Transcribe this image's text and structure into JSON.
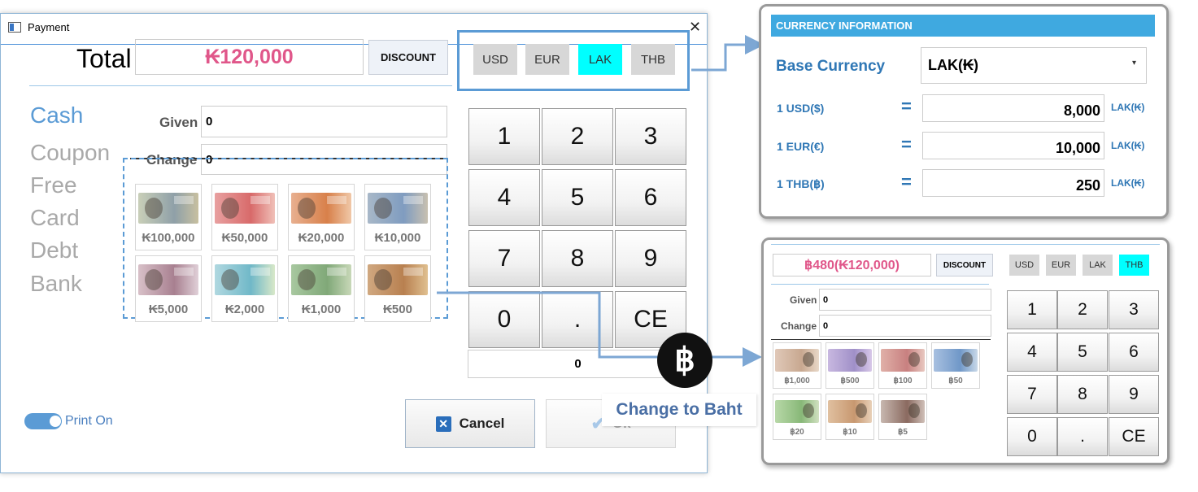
{
  "window": {
    "title": "Payment"
  },
  "total": {
    "label": "Total",
    "value": "₭120,000"
  },
  "discount_label": "DISCOUNT",
  "currencies": [
    "USD",
    "EUR",
    "LAK",
    "THB"
  ],
  "active_currency": "LAK",
  "payment_methods": [
    "Cash",
    "Coupon",
    "Free",
    "Card",
    "Debt",
    "Bank"
  ],
  "active_method": "Cash",
  "given": {
    "label": "Given",
    "value": "0"
  },
  "change": {
    "label": "Change",
    "value": "0"
  },
  "banknotes": [
    "₭100,000",
    "₭50,000",
    "₭20,000",
    "₭10,000",
    "₭5,000",
    "₭2,000",
    "₭1,000",
    "₭500"
  ],
  "keypad": [
    "1",
    "2",
    "3",
    "4",
    "5",
    "6",
    "7",
    "8",
    "9",
    "0",
    ".",
    "CE"
  ],
  "keypad_display": "0",
  "print_toggle": {
    "label": "Print On",
    "on": true
  },
  "cancel_label": "Cancel",
  "ok_label": "Ok",
  "currency_info": {
    "header": "CURRENCY INFORMATION",
    "base_label": "Base Currency",
    "base_value": "LAK(₭)",
    "rates": [
      {
        "label": "1 USD($)",
        "eq": "=",
        "value": "8,000",
        "unit": "LAK(₭)"
      },
      {
        "label": "1 EUR(€)",
        "eq": "=",
        "value": "10,000",
        "unit": "LAK(₭)"
      },
      {
        "label": "1 THB(฿)",
        "eq": "=",
        "value": "250",
        "unit": "LAK(₭)"
      }
    ]
  },
  "annotation": {
    "badge": "฿",
    "text": "Change to Baht"
  },
  "preview": {
    "total": "฿480(₭120,000)",
    "discount_label": "DISCOUNT",
    "currencies": [
      "USD",
      "EUR",
      "LAK",
      "THB"
    ],
    "active_currency": "THB",
    "given": {
      "label": "Given",
      "value": "0"
    },
    "change": {
      "label": "Change",
      "value": "0"
    },
    "banknotes": [
      "฿1,000",
      "฿500",
      "฿100",
      "฿50",
      "฿20",
      "฿10",
      "฿5"
    ],
    "keypad": [
      "1",
      "2",
      "3",
      "4",
      "5",
      "6",
      "7",
      "8",
      "9",
      "0",
      ".",
      "CE"
    ]
  },
  "colors": {
    "accent": "#5b9bd5",
    "total_text": "#e0578a",
    "active_currency_bg": "#00ffff",
    "info_header_bg": "#3fa9e0"
  }
}
